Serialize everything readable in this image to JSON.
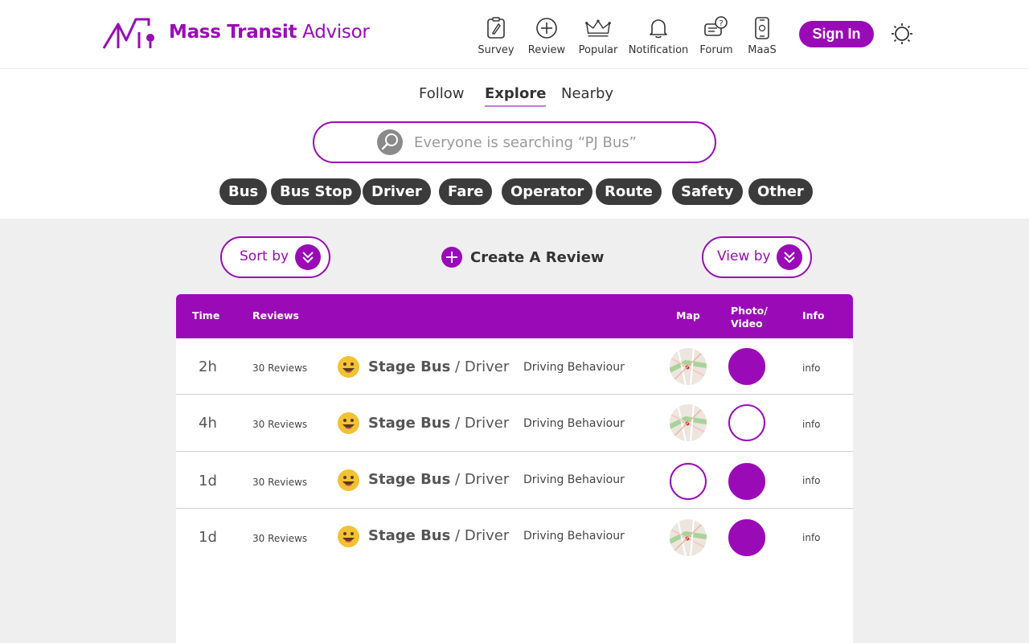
{
  "brand": {
    "name_strong": "Mass Transit",
    "name_light": " Advisor",
    "logo_icon": "mass-transit-logo"
  },
  "nav": [
    {
      "label": "Survey",
      "icon": "survey-icon"
    },
    {
      "label": "Review",
      "icon": "plus-circle-icon"
    },
    {
      "label": "Popular",
      "icon": "crown-icon"
    },
    {
      "label": "Notification",
      "icon": "bell-icon"
    },
    {
      "label": "Forum",
      "icon": "chat-icon"
    },
    {
      "label": "MaaS",
      "icon": "phone-icon"
    }
  ],
  "signin_label": "Sign In",
  "tabs": {
    "follow": "Follow",
    "explore": "Explore",
    "nearby": "Nearby",
    "active": "Explore"
  },
  "search": {
    "placeholder": "Everyone is searching “PJ Bus”"
  },
  "chips": [
    "Bus",
    "Bus Stop",
    "Driver",
    "Fare",
    "Operator",
    "Route",
    "Safety",
    "Other"
  ],
  "controls": {
    "sort_label": "Sort by",
    "create_label": "Create A Review",
    "view_label": "View by"
  },
  "table": {
    "headers": {
      "time": "Time",
      "reviews": "Reviews",
      "map": "Map",
      "photo_line1": "Photo/",
      "photo_line2": "Video",
      "info": "Info"
    },
    "rows": [
      {
        "time": "2h",
        "reviews": "30 Reviews",
        "title_bold": "Stage Bus",
        "title_rest": " / Driver",
        "category": "Driving Behaviour",
        "map": "thumbnail",
        "photo": "filled",
        "info": "info"
      },
      {
        "time": "4h",
        "reviews": "30 Reviews",
        "title_bold": "Stage Bus",
        "title_rest": " / Driver",
        "category": "Driving Behaviour",
        "map": "thumbnail",
        "photo": "empty",
        "info": "info"
      },
      {
        "time": "1d",
        "reviews": "30 Reviews",
        "title_bold": "Stage Bus",
        "title_rest": " / Driver",
        "category": "Driving Behaviour",
        "map": "empty",
        "photo": "filled",
        "info": "info"
      },
      {
        "time": "1d",
        "reviews": "30 Reviews",
        "title_bold": "Stage Bus",
        "title_rest": " / Driver",
        "category": "Driving Behaviour",
        "map": "thumbnail",
        "photo": "filled",
        "info": "info"
      }
    ]
  },
  "colors": {
    "accent": "#9a0bb7",
    "chip_bg": "#3b3b3b",
    "page_bg": "#efefef"
  }
}
